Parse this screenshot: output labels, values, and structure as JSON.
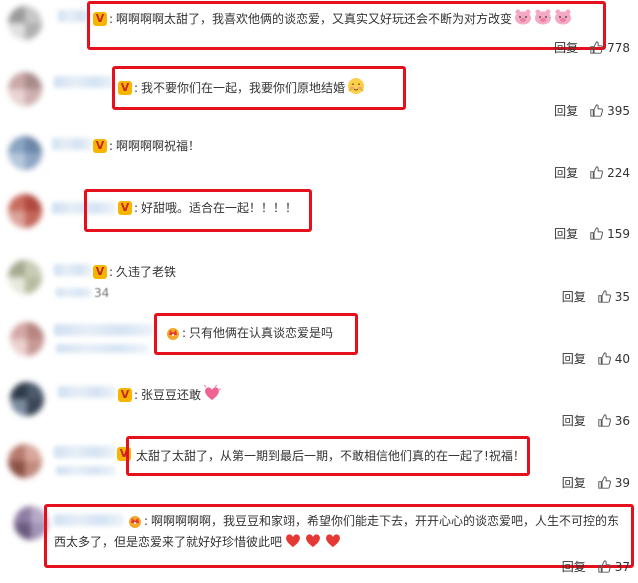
{
  "comments": [
    {
      "text": "啊啊啊啊太甜了，我喜欢他俩的谈恋爱，又真实又好玩还会不断为对方改变",
      "reply": "回复",
      "likes": "778",
      "badge": "v",
      "emoji": [
        "pig-face-icon",
        "pig-face-icon",
        "pig-face-icon"
      ]
    },
    {
      "text": "我不要你们在一起，我要你们原地结婚",
      "reply": "回复",
      "likes": "395",
      "badge": "v",
      "emoji": [
        "shy-face-icon"
      ]
    },
    {
      "text": "啊啊啊啊祝福！",
      "reply": "回复",
      "likes": "224",
      "badge": "v",
      "emoji": []
    },
    {
      "text": "好甜哦。适合在一起！！！！",
      "reply": "回复",
      "likes": "159",
      "badge": "v",
      "emoji": []
    },
    {
      "text": "久违了老铁",
      "reply": "回复",
      "likes": "35",
      "badge": "v",
      "sub": "34",
      "emoji": []
    },
    {
      "text": "只有他俩在认真谈恋爱是吗",
      "reply": "回复",
      "likes": "40",
      "badge": "crown",
      "emoji": []
    },
    {
      "text": "张豆豆还敢",
      "reply": "回复",
      "likes": "36",
      "badge": "v",
      "emoji": [
        "heart-burst-icon"
      ]
    },
    {
      "text": "太甜了太甜了，从第一期到最后一期，不敢相信他们真的在一起了!祝福！",
      "reply": "回复",
      "likes": "39",
      "badge": "v",
      "emoji": []
    },
    {
      "text": "啊啊啊啊啊，我豆豆和家翊，希望你们能走下去，开开心心的谈恋爱吧，人生不可控的东",
      "text2": "西太多了，但是恋爱来了就好好珍惜彼此吧",
      "reply": "回复",
      "likes": "37",
      "badge": "crown",
      "emoji": [
        "red-heart-icon",
        "red-heart-icon",
        "red-heart-icon"
      ]
    }
  ],
  "colors": {
    "highlight": "#e5101b",
    "badge_v": "#f7b500",
    "text": "#333333"
  }
}
